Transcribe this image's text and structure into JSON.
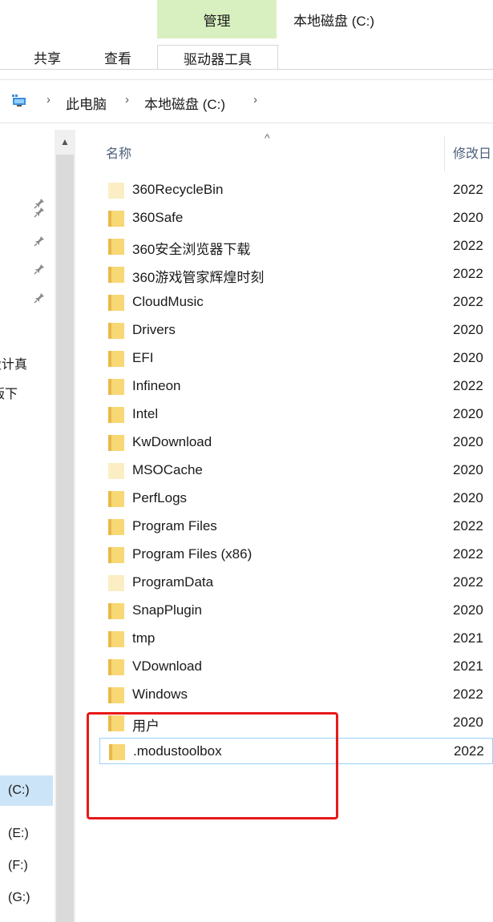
{
  "ribbon": {
    "context_header": "管理",
    "window_title": "本地磁盘 (C:)",
    "tabs": [
      {
        "label": "共享"
      },
      {
        "label": "查看"
      },
      {
        "label": "驱动器工具"
      }
    ]
  },
  "address_bar": {
    "icon": "pc-icon",
    "segments": [
      "此电脑",
      "本地磁盘 (C:)"
    ],
    "separator": "›"
  },
  "nav_pane": {
    "pin_icons": 4,
    "labels": [
      "设计真",
      "版下",
      "(C:)",
      "(E:)",
      "(F:)",
      "(G:)"
    ]
  },
  "columns": {
    "sort_indicator": "^",
    "name": "名称",
    "modified": "修改日"
  },
  "files": [
    {
      "name": "360RecycleBin",
      "date": "2022",
      "faded": true
    },
    {
      "name": "360Safe",
      "date": "2020",
      "faded": false
    },
    {
      "name": "360安全浏览器下载",
      "date": "2022",
      "faded": false
    },
    {
      "name": "360游戏管家辉煌时刻",
      "date": "2022",
      "faded": false
    },
    {
      "name": "CloudMusic",
      "date": "2022",
      "faded": false
    },
    {
      "name": "Drivers",
      "date": "2020",
      "faded": false
    },
    {
      "name": "EFI",
      "date": "2020",
      "faded": false
    },
    {
      "name": "Infineon",
      "date": "2022",
      "faded": false
    },
    {
      "name": "Intel",
      "date": "2020",
      "faded": false
    },
    {
      "name": "KwDownload",
      "date": "2020",
      "faded": false
    },
    {
      "name": "MSOCache",
      "date": "2020",
      "faded": true
    },
    {
      "name": "PerfLogs",
      "date": "2020",
      "faded": false
    },
    {
      "name": "Program Files",
      "date": "2022",
      "faded": false
    },
    {
      "name": "Program Files (x86)",
      "date": "2022",
      "faded": false
    },
    {
      "name": "ProgramData",
      "date": "2022",
      "faded": true
    },
    {
      "name": "SnapPlugin",
      "date": "2020",
      "faded": false
    },
    {
      "name": "tmp",
      "date": "2021",
      "faded": false
    },
    {
      "name": "VDownload",
      "date": "2021",
      "faded": false
    },
    {
      "name": "Windows",
      "date": "2022",
      "faded": false
    },
    {
      "name": "用户",
      "date": "2020",
      "faded": false
    },
    {
      "name": ".modustoolbox",
      "date": "2022",
      "faded": false,
      "selected": true
    }
  ],
  "colors": {
    "context_tab_bg": "#d8f0c0",
    "folder": "#f8d775",
    "folder_dark": "#e8b84a",
    "folder_faded": "#fbeec4",
    "selection": "#cce4f7",
    "highlight_box": "#e81818"
  }
}
